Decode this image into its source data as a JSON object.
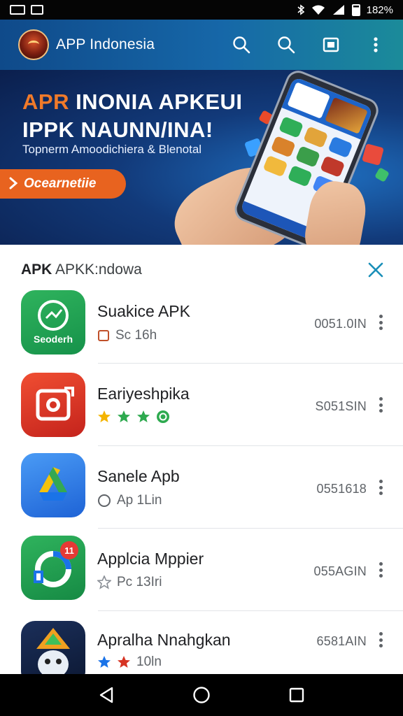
{
  "status_bar": {
    "battery_text": "182%"
  },
  "app_bar": {
    "title": "APP Indonesia"
  },
  "banner": {
    "line1_accent": "APR",
    "line1_rest": " INONIA APKEUI",
    "line2": "IPPK NAUNN/INA!",
    "subtitle": "Topnerm Amoodichiera & Blenotal",
    "cta_label": "Ocearnetiie"
  },
  "list": {
    "title_bold": "APK",
    "title_rest": " APKK:ndowa",
    "items": [
      {
        "name": "Suakice APK",
        "meta": "Sc 16h",
        "size": "0051.0IN",
        "icon_label": "Seoderh"
      },
      {
        "name": "Eariyeshpika",
        "meta": "",
        "size": "S051SIN",
        "icon_label": ""
      },
      {
        "name": "Sanele Apb",
        "meta": "Ap 1Lin",
        "size": "0551618",
        "icon_label": ""
      },
      {
        "name": "Applcia Mppier",
        "meta": "Pc 13Iri",
        "size": "055AGIN",
        "icon_label": "",
        "badge": "11"
      },
      {
        "name": "Apralha Nnahgkan",
        "meta": "10ln",
        "size": "6581AIN",
        "icon_label": ""
      }
    ]
  },
  "colors": {
    "app_bar_start": "#0f4a8a",
    "app_bar_end": "#1b8b9a",
    "cta": "#e8631f",
    "accent_teal": "#1a8fb8"
  }
}
